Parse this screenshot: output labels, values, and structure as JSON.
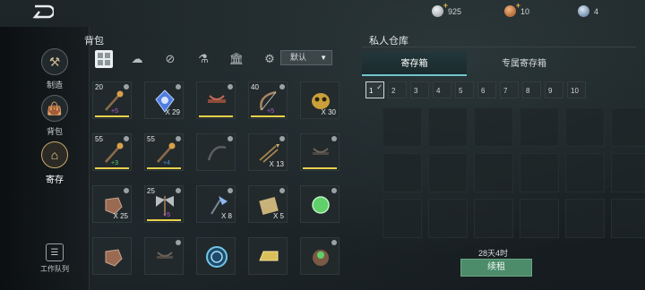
{
  "topbar": {
    "currencies": [
      {
        "icon": "silver-coin-icon",
        "value": "925",
        "color": "#b8bec2"
      },
      {
        "icon": "copper-coin-icon",
        "value": "10",
        "color": "#c97a3d"
      },
      {
        "icon": "gem-icon",
        "value": "4",
        "color": "#8fb3d9"
      }
    ]
  },
  "leftnav": {
    "items": [
      {
        "label": "制造",
        "icon": "craft-icon"
      },
      {
        "label": "背包",
        "icon": "bag-icon"
      },
      {
        "label": "寄存",
        "icon": "storehouse-icon"
      }
    ],
    "workqueue_label": "工作队列"
  },
  "backpack": {
    "title": "背包",
    "filter_tabs": [
      "all-icon",
      "material-icon",
      "weapon-icon",
      "potion-icon",
      "building-icon",
      "anvil-icon"
    ],
    "sort_label": "默认",
    "slots": [
      {
        "level": "20",
        "qty": "",
        "plus": "+5",
        "plus_color": "#b65bd6",
        "art": "staff",
        "bar": "#e8d24a",
        "lock": true
      },
      {
        "level": "",
        "qty": "X 29",
        "plus": "",
        "art": "blue-crystal",
        "bar": "",
        "lock": true
      },
      {
        "level": "",
        "qty": "",
        "plus": "",
        "art": "crossbow",
        "bar": "#e8d24a",
        "lock": true
      },
      {
        "level": "40",
        "qty": "",
        "plus": "+5",
        "plus_color": "#b65bd6",
        "art": "bow",
        "bar": "#e8d24a",
        "lock": true
      },
      {
        "level": "",
        "qty": "X 30",
        "plus": "",
        "art": "gold-mask",
        "bar": "",
        "lock": false
      },
      {
        "level": "55",
        "qty": "",
        "plus": "+3",
        "plus_color": "#4fd06a",
        "art": "staff",
        "bar": "#e8d24a",
        "lock": true
      },
      {
        "level": "55",
        "qty": "",
        "plus": "+4",
        "plus_color": "#4a8fe0",
        "art": "staff",
        "bar": "#e8d24a",
        "lock": true
      },
      {
        "level": "",
        "qty": "",
        "plus": "",
        "art": "dark-bow",
        "bar": "",
        "lock": true
      },
      {
        "level": "",
        "qty": "X 13",
        "plus": "",
        "art": "arrows",
        "bar": "",
        "lock": true
      },
      {
        "level": "",
        "qty": "",
        "plus": "",
        "art": "dark-crossbow",
        "bar": "#e8d24a",
        "lock": true
      },
      {
        "level": "",
        "qty": "X 25",
        "plus": "",
        "art": "leather",
        "bar": "",
        "lock": true
      },
      {
        "level": "25",
        "qty": "",
        "plus": "+5",
        "plus_color": "#b65bd6",
        "art": "double-axe",
        "bar": "#e8d24a",
        "lock": true
      },
      {
        "level": "",
        "qty": "X 8",
        "plus": "",
        "art": "ice-axe",
        "bar": "",
        "lock": true
      },
      {
        "level": "",
        "qty": "X 5",
        "plus": "",
        "art": "scroll",
        "bar": "",
        "lock": true
      },
      {
        "level": "",
        "qty": "",
        "plus": "",
        "art": "green-orb",
        "bar": "",
        "lock": true
      },
      {
        "level": "",
        "qty": "",
        "plus": "",
        "art": "leather",
        "bar": "",
        "lock": false
      },
      {
        "level": "",
        "qty": "",
        "plus": "",
        "art": "dark-crossbow",
        "bar": "",
        "lock": true
      },
      {
        "level": "",
        "qty": "",
        "plus": "",
        "art": "blue-portal",
        "bar": "",
        "lock": false
      },
      {
        "level": "",
        "qty": "",
        "plus": "",
        "art": "gold-bar",
        "bar": "",
        "lock": false
      },
      {
        "level": "",
        "qty": "",
        "plus": "",
        "art": "green-gem-pouch",
        "bar": "",
        "lock": true
      }
    ]
  },
  "warehouse": {
    "title": "私人仓库",
    "tabs": [
      "寄存箱",
      "专属寄存箱"
    ],
    "numbers": [
      "1",
      "2",
      "3",
      "4",
      "5",
      "6",
      "7",
      "8",
      "9",
      "10"
    ],
    "remaining": "28天4时",
    "renew_label": "续租"
  }
}
